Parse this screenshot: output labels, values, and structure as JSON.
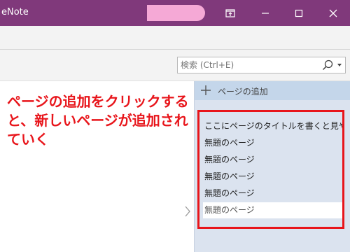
{
  "window": {
    "app_title": "eNote",
    "accent_color": "#80397b",
    "buttons": [
      "restore-view-icon",
      "minimize-icon",
      "maximize-icon",
      "close-icon"
    ]
  },
  "search": {
    "placeholder": "検索 (Ctrl+E)"
  },
  "annotation": {
    "text": "ページの追加をクリックすると、新しいページが追加されていく",
    "color": "#e8151b"
  },
  "page_pane": {
    "add_page_label": "ページの追加",
    "pages": [
      "ここにページのタイトルを書くと見やすい",
      "無題のページ",
      "無題のページ",
      "無題のページ",
      "無題のページ",
      "無題のページ"
    ],
    "selected_index": 5,
    "highlight_color": "#e8151b"
  }
}
